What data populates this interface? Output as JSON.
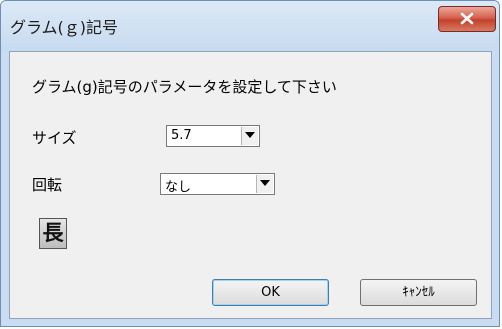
{
  "window": {
    "title": "グラム(ｇ)記号"
  },
  "dialog": {
    "prompt": "グラム(g)記号のパラメータを設定して下さい",
    "size_label": "サイズ",
    "size_value": "5.7",
    "rotation_label": "回転",
    "rotation_value": "なし",
    "long_button_label": "長",
    "ok_label": "OK",
    "cancel_label": "ｷｬﾝｾﾙ"
  },
  "colors": {
    "close_button": "#c9432f",
    "title_bar": "#c9dcf1",
    "client_background": "#f0f0f0"
  }
}
